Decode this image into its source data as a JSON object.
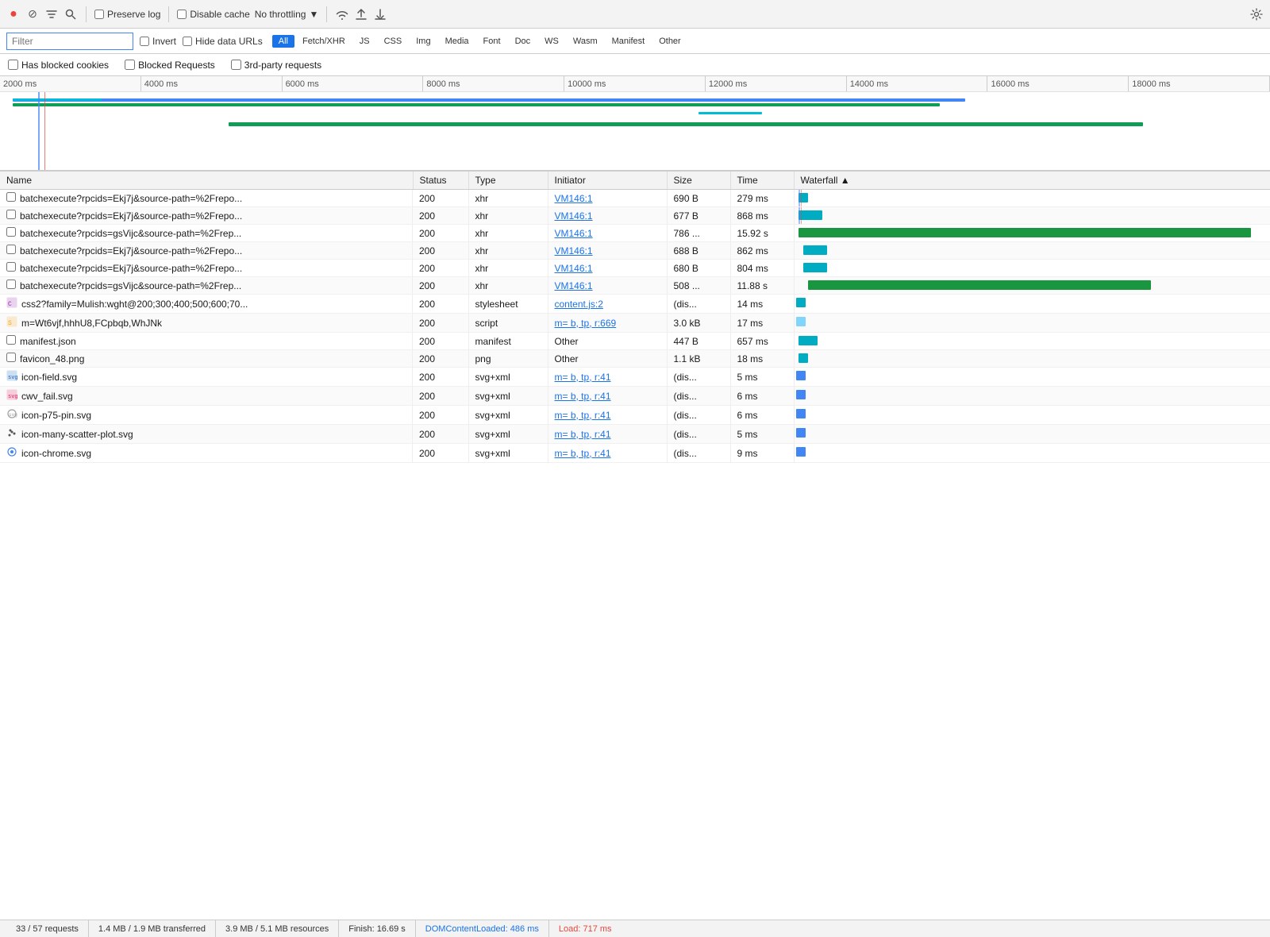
{
  "toolbar": {
    "record_label": "●",
    "clear_label": "⊘",
    "filter_label": "▽",
    "search_label": "🔍",
    "preserve_log_label": "Preserve log",
    "disable_cache_label": "Disable cache",
    "throttling_label": "No throttling",
    "throttling_icon": "▼",
    "wifi_icon": "wifi",
    "upload_icon": "↑",
    "download_icon": "↓",
    "gear_label": "⚙"
  },
  "filter_bar": {
    "filter_placeholder": "Filter",
    "invert_label": "Invert",
    "hide_data_urls_label": "Hide data URLs",
    "type_buttons": [
      "All",
      "Fetch/XHR",
      "JS",
      "CSS",
      "Img",
      "Media",
      "Font",
      "Doc",
      "WS",
      "Wasm",
      "Manifest",
      "Other"
    ],
    "active_type": "All"
  },
  "checkbox_row": {
    "has_blocked_cookies": "Has blocked cookies",
    "blocked_requests": "Blocked Requests",
    "third_party": "3rd-party requests"
  },
  "timeline": {
    "ticks": [
      "2000 ms",
      "4000 ms",
      "6000 ms",
      "8000 ms",
      "10000 ms",
      "12000 ms",
      "14000 ms",
      "16000 ms",
      "18000 ms"
    ]
  },
  "table": {
    "columns": [
      "Name",
      "Status",
      "Type",
      "Initiator",
      "Size",
      "Time",
      "Waterfall"
    ],
    "rows": [
      {
        "name": "batchexecute?rpcids=Ekj7j&source-path=%2Frepo...",
        "status": "200",
        "type": "xhr",
        "initiator": "VM146:1",
        "initiator_link": true,
        "size": "690 B",
        "time": "279 ms",
        "waterfall_type": "teal",
        "waterfall_start": 1,
        "waterfall_width": 2,
        "icon": "checkbox",
        "icon_color": ""
      },
      {
        "name": "batchexecute?rpcids=Ekj7j&source-path=%2Frepo...",
        "status": "200",
        "type": "xhr",
        "initiator": "VM146:1",
        "initiator_link": true,
        "size": "677 B",
        "time": "868 ms",
        "waterfall_type": "teal",
        "waterfall_start": 1,
        "waterfall_width": 5,
        "icon": "checkbox",
        "icon_color": ""
      },
      {
        "name": "batchexecute?rpcids=gsVijc&source-path=%2Frep...",
        "status": "200",
        "type": "xhr",
        "initiator": "VM146:1",
        "initiator_link": true,
        "size": "786 ...",
        "time": "15.92 s",
        "waterfall_type": "green",
        "waterfall_start": 1,
        "waterfall_width": 95,
        "icon": "checkbox",
        "icon_color": ""
      },
      {
        "name": "batchexecute?rpcids=Ekj7j&source-path=%2Frepo...",
        "status": "200",
        "type": "xhr",
        "initiator": "VM146:1",
        "initiator_link": true,
        "size": "688 B",
        "time": "862 ms",
        "waterfall_type": "teal",
        "waterfall_start": 2,
        "waterfall_width": 5,
        "icon": "checkbox",
        "icon_color": ""
      },
      {
        "name": "batchexecute?rpcids=Ekj7j&source-path=%2Frepo...",
        "status": "200",
        "type": "xhr",
        "initiator": "VM146:1",
        "initiator_link": true,
        "size": "680 B",
        "time": "804 ms",
        "waterfall_type": "teal",
        "waterfall_start": 2,
        "waterfall_width": 5,
        "icon": "checkbox",
        "icon_color": ""
      },
      {
        "name": "batchexecute?rpcids=gsVijc&source-path=%2Frep...",
        "status": "200",
        "type": "xhr",
        "initiator": "VM146:1",
        "initiator_link": true,
        "size": "508 ...",
        "time": "11.88 s",
        "waterfall_type": "green",
        "waterfall_start": 3,
        "waterfall_width": 72,
        "icon": "checkbox",
        "icon_color": ""
      },
      {
        "name": "css2?family=Mulish:wght@200;300;400;500;600;70...",
        "status": "200",
        "type": "stylesheet",
        "initiator": "content.js:2",
        "initiator_link": true,
        "size": "(dis...",
        "time": "14 ms",
        "waterfall_type": "teal",
        "waterfall_start": 0.5,
        "waterfall_width": 1,
        "icon": "css",
        "icon_color": "#9c27b0"
      },
      {
        "name": "m=Wt6vjf,hhhU8,FCpbqb,WhJNk",
        "status": "200",
        "type": "script",
        "initiator": "m= b, tp, r:669",
        "initiator_link": true,
        "size": "3.0 kB",
        "time": "17 ms",
        "waterfall_type": "light-blue",
        "waterfall_start": 0.5,
        "waterfall_width": 1,
        "icon": "script",
        "icon_color": "#f9a825"
      },
      {
        "name": "manifest.json",
        "status": "200",
        "type": "manifest",
        "initiator": "Other",
        "initiator_link": false,
        "size": "447 B",
        "time": "657 ms",
        "waterfall_type": "teal",
        "waterfall_start": 1,
        "waterfall_width": 4,
        "icon": "checkbox",
        "icon_color": ""
      },
      {
        "name": "favicon_48.png",
        "status": "200",
        "type": "png",
        "initiator": "Other",
        "initiator_link": false,
        "size": "1.1 kB",
        "time": "18 ms",
        "waterfall_type": "teal",
        "waterfall_start": 1,
        "waterfall_width": 1,
        "icon": "checkbox",
        "icon_color": ""
      },
      {
        "name": "icon-field.svg",
        "status": "200",
        "type": "svg+xml",
        "initiator": "m= b, tp, r:41",
        "initiator_link": true,
        "size": "(dis...",
        "time": "5 ms",
        "waterfall_type": "blue",
        "waterfall_start": 0.5,
        "waterfall_width": 1,
        "icon": "svg",
        "icon_color": "#1565c0"
      },
      {
        "name": "cwv_fail.svg",
        "status": "200",
        "type": "svg+xml",
        "initiator": "m= b, tp, r:41",
        "initiator_link": true,
        "size": "(dis...",
        "time": "6 ms",
        "waterfall_type": "blue",
        "waterfall_start": 0.5,
        "waterfall_width": 1,
        "icon": "svg-pink",
        "icon_color": "#e91e63"
      },
      {
        "name": "icon-p75-pin.svg",
        "status": "200",
        "type": "svg+xml",
        "initiator": "m= b, tp, r:41",
        "initiator_link": true,
        "size": "(dis...",
        "time": "6 ms",
        "waterfall_type": "blue",
        "waterfall_start": 0.5,
        "waterfall_width": 1,
        "icon": "svg-circle",
        "icon_color": "#9e9e9e"
      },
      {
        "name": "icon-many-scatter-plot.svg",
        "status": "200",
        "type": "svg+xml",
        "initiator": "m= b, tp, r:41",
        "initiator_link": true,
        "size": "(dis...",
        "time": "5 ms",
        "waterfall_type": "blue",
        "waterfall_start": 0.5,
        "waterfall_width": 1,
        "icon": "svg-scatter",
        "icon_color": "#333"
      },
      {
        "name": "icon-chrome.svg",
        "status": "200",
        "type": "svg+xml",
        "initiator": "m= b, tp, r:41",
        "initiator_link": true,
        "size": "(dis...",
        "time": "9 ms",
        "waterfall_type": "blue",
        "waterfall_start": 0.5,
        "waterfall_width": 1,
        "icon": "svg-chrome",
        "icon_color": "#4285f4"
      }
    ]
  },
  "status_bar": {
    "requests": "33 / 57 requests",
    "transferred": "1.4 MB / 1.9 MB transferred",
    "resources": "3.9 MB / 5.1 MB resources",
    "finish": "Finish: 16.69 s",
    "dom_content_loaded": "DOMContentLoaded: 486 ms",
    "load": "Load: 717 ms"
  }
}
